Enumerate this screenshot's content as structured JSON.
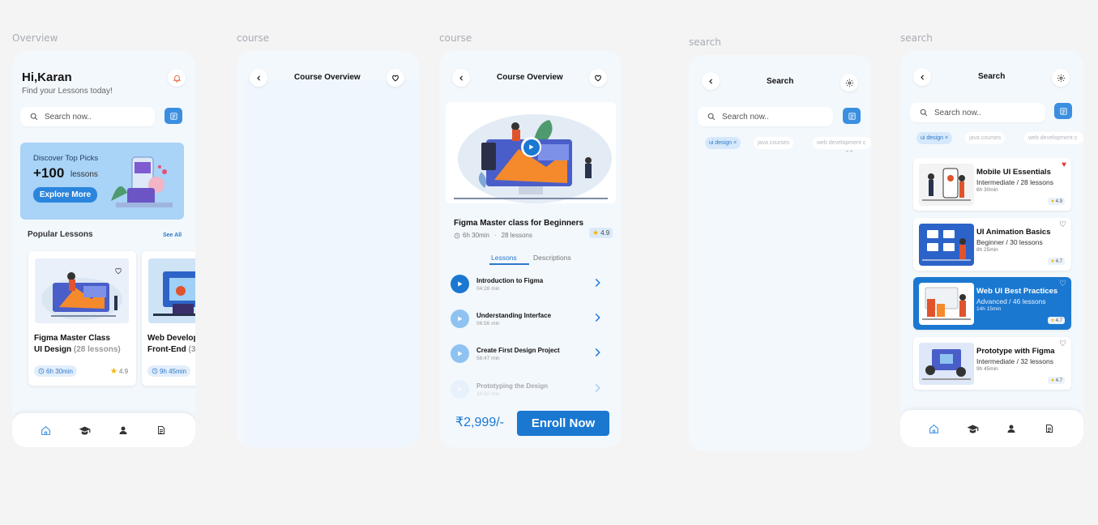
{
  "frames": {
    "f1_label": "Overview",
    "f2_label": "course",
    "f3_label": "course",
    "f4_label": "search",
    "f5_label": "search"
  },
  "home": {
    "greeting": "Hi,Karan",
    "subtitle": "Find your Lessons today!",
    "search_placeholder": "Search now..",
    "banner": {
      "title": "Discover Top Picks",
      "count": "+100",
      "count_suffix": "lessons",
      "button": "Explore More"
    },
    "popular_title": "Popular Lessons",
    "see_all": "See All",
    "cards": [
      {
        "title_line1": "Figma Master Class",
        "title_line2": "UI Design",
        "lessons": "(28 lessons)",
        "duration": "6h 30min",
        "rating": "4.9"
      },
      {
        "title_line1": "Web Develop",
        "title_line2": "Front-End",
        "lessons": "(3",
        "duration": "9h 45min",
        "rating": ""
      }
    ]
  },
  "course_empty": {
    "title": "Course Overview"
  },
  "course": {
    "title": "Course Overview",
    "name": "Figma Master class for Beginners",
    "duration": "6h 30min",
    "lessons": "28 lessons",
    "rating": "4.9",
    "tabs": [
      "Lessons",
      "Descriptions"
    ],
    "lesson_list": [
      {
        "title": "Introduction to Figma",
        "duration": "04:28 min"
      },
      {
        "title": "Understanding Interface",
        "duration": "06:56 min"
      },
      {
        "title": "Create First Design Project",
        "duration": "56:47 min"
      },
      {
        "title": "Prototyping the Design",
        "duration": "34:32 min"
      }
    ],
    "price": "₹2,999/-",
    "enroll": "Enroll Now"
  },
  "search_empty": {
    "title": "Search",
    "placeholder": "Search now..",
    "chips": [
      "ui design ×",
      "java courses",
      "web development c"
    ]
  },
  "search": {
    "title": "Search",
    "placeholder": "Search now..",
    "chips": [
      "ui design ×",
      "java courses",
      "web development c"
    ],
    "results": [
      {
        "title": "Mobile UI Essentials",
        "sub": "Intermediate / 28 lessons",
        "dur": "6h 30min",
        "rating": "4.9"
      },
      {
        "title": "UI Animation Basics",
        "sub": "Beginner / 30 lessons",
        "dur": "8h 25min",
        "rating": "4.7"
      },
      {
        "title": "Web UI Best Practices",
        "sub": "Advanced / 46 lessons",
        "dur": "14h 15min",
        "rating": "4.7"
      },
      {
        "title": "Prototype with Figma",
        "sub": "Intermediate / 32 lessons",
        "dur": "9h 45min",
        "rating": "4.7"
      }
    ]
  },
  "colors": {
    "primary": "#1b78d1",
    "accent": "#3b8fe0",
    "banner": "#a9d3f7",
    "star": "#f5b400",
    "heart": "#e5383b"
  }
}
